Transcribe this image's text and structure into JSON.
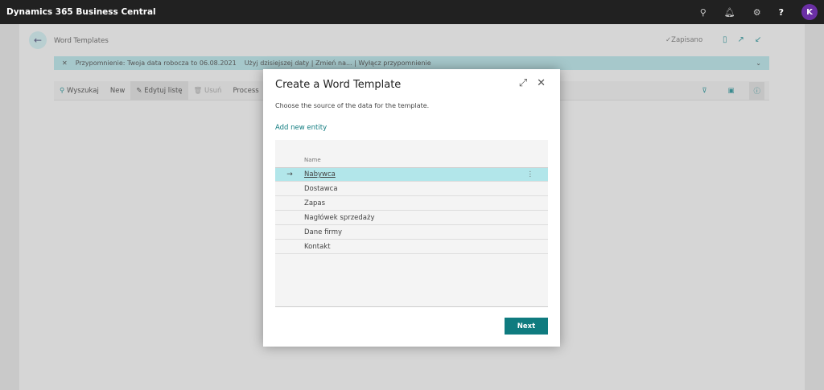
{
  "app": {
    "title": "Dynamics 365 Business Central",
    "avatar": "K",
    "icons": [
      "search-icon",
      "bell-icon",
      "gear-icon",
      "help-icon"
    ]
  },
  "page": {
    "title": "Word Templates",
    "saved": "Zapisano"
  },
  "banner": {
    "text": "Przypomnienie: Twoja data robocza to 06.08.2021",
    "links": "Użyj dzisiejszej daty | Zmień na... | Wyłącz przypomnienie"
  },
  "actions": {
    "search": "Wyszukaj",
    "new": "New",
    "edit": "Edytuj listę",
    "delete": "Usuń",
    "process": "Process"
  },
  "modal": {
    "title": "Create a Word Template",
    "subtitle": "Choose the source of the data for the template.",
    "add_entity": "Add new entity",
    "column": "Name",
    "rows": [
      "Nabywca",
      "Dostawca",
      "Zapas",
      "Nagłówek sprzedaży",
      "Dane firmy",
      "Kontakt"
    ],
    "selected": "Nabywca",
    "next": "Next"
  },
  "colors": {
    "accent": "#0f7b7f",
    "selected_row": "#b2e6ea",
    "banner": "#a6c8cb"
  }
}
